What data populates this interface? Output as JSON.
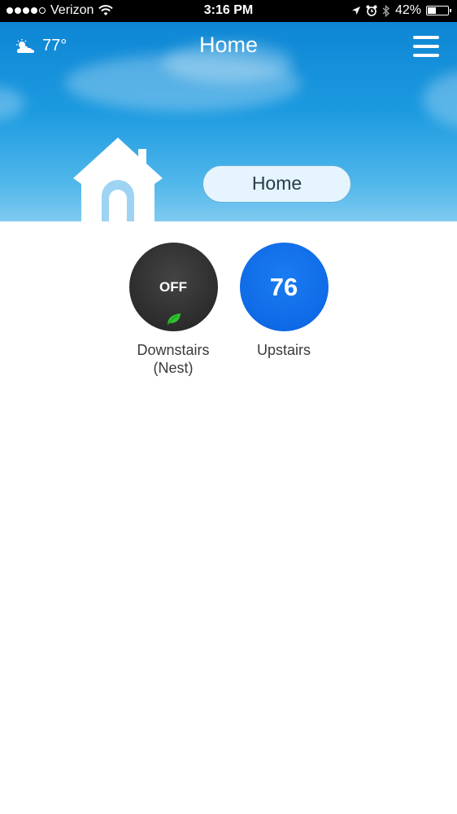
{
  "status_bar": {
    "carrier": "Verizon",
    "time": "3:16 PM",
    "battery": "42%",
    "battery_level": 0.42,
    "signal_bars": 4
  },
  "header": {
    "weather_temp": "77°",
    "weather_icon": "partly-cloudy-icon",
    "title": "Home",
    "menu_icon": "hamburger-menu-icon"
  },
  "structure_button": {
    "label": "Home"
  },
  "thermostats": [
    {
      "value": "OFF",
      "label_line1": "Downstairs",
      "label_line2": "(Nest)",
      "mode": "off",
      "leaf": true,
      "color": "#2c2c2c"
    },
    {
      "value": "76",
      "label_line1": "Upstairs",
      "label_line2": "",
      "mode": "on",
      "color": "#0f6ae6"
    }
  ],
  "colors": {
    "header_blue": "#1c9ae0",
    "leaf_green": "#2fc32f"
  }
}
